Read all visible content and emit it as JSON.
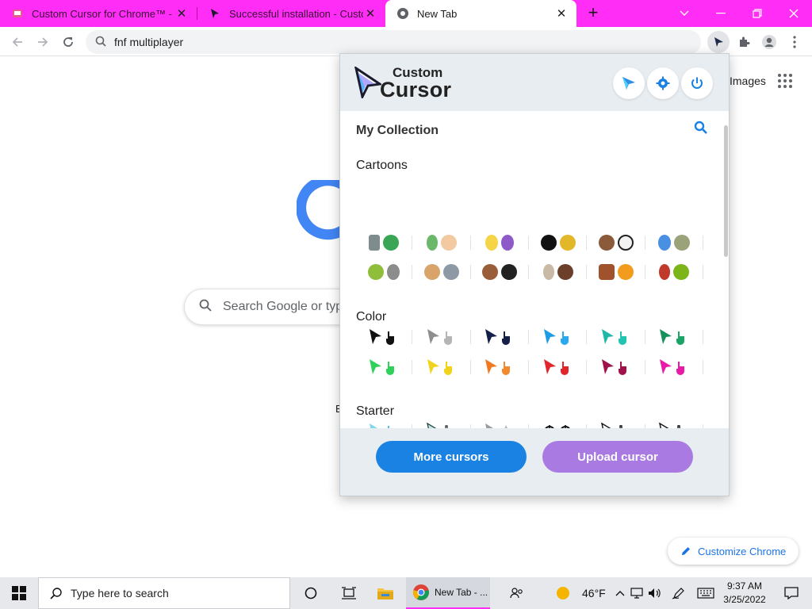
{
  "tabs": [
    {
      "label": "Custom Cursor for Chrome™ - C"
    },
    {
      "label": "Successful installation - Custom"
    },
    {
      "label": "New Tab"
    }
  ],
  "new_tab": "+",
  "address": {
    "value": "fnf multiplayer"
  },
  "google": {
    "images_link": "Images",
    "search_placeholder": "Search Google or type a URL",
    "stray_text": "E",
    "customize": "Customize Chrome"
  },
  "popup": {
    "logo_line1": "Custom",
    "logo_line2": "Cursor",
    "collection_title": "My Collection",
    "sections": {
      "cartoons": "Cartoons",
      "color": "Color",
      "starter": "Starter"
    },
    "more_button": "More cursors",
    "upload_button": "Upload cursor"
  },
  "taskbar": {
    "search_placeholder": "Type here to search",
    "chrome_label": "New Tab - ...",
    "temperature": "46°F",
    "time": "9:37 AM",
    "date": "3/25/2022"
  },
  "colors": {
    "tabstrip": "#ff2df5",
    "more_button": "#1a82e2",
    "upload_button": "#a97be2",
    "accent": "#1a73e8"
  }
}
